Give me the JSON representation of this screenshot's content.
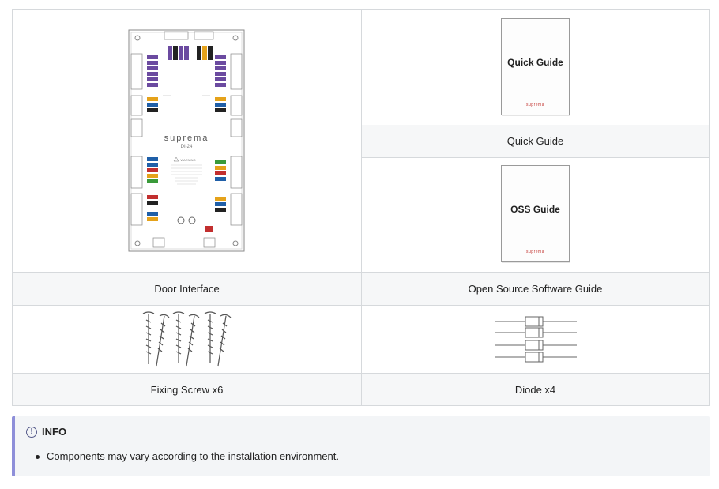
{
  "components": [
    {
      "caption": "Door Interface",
      "image": "door-interface-board",
      "device_brand": "suprema",
      "device_model": "DI-24",
      "warning_label": "WARNING"
    },
    {
      "caption": "Quick Guide",
      "image": "quick-guide-booklet",
      "booklet_title": "Quick Guide",
      "booklet_logo": "suprema"
    },
    {
      "caption": "Open Source Software Guide",
      "image": "oss-guide-booklet",
      "booklet_title": "OSS Guide",
      "booklet_logo": "suprema"
    },
    {
      "caption": "Fixing Screw x6",
      "image": "screws"
    },
    {
      "caption": "Diode x4",
      "image": "diodes"
    }
  ],
  "info": {
    "icon": "info-circle-icon",
    "title": "INFO",
    "items": [
      "Components may vary according to the installation environment."
    ],
    "accent_color": "#8e8fd9",
    "background_color": "#f3f5f7"
  },
  "border_color": "#d6d9dc",
  "caption_background": "#f6f7f8"
}
